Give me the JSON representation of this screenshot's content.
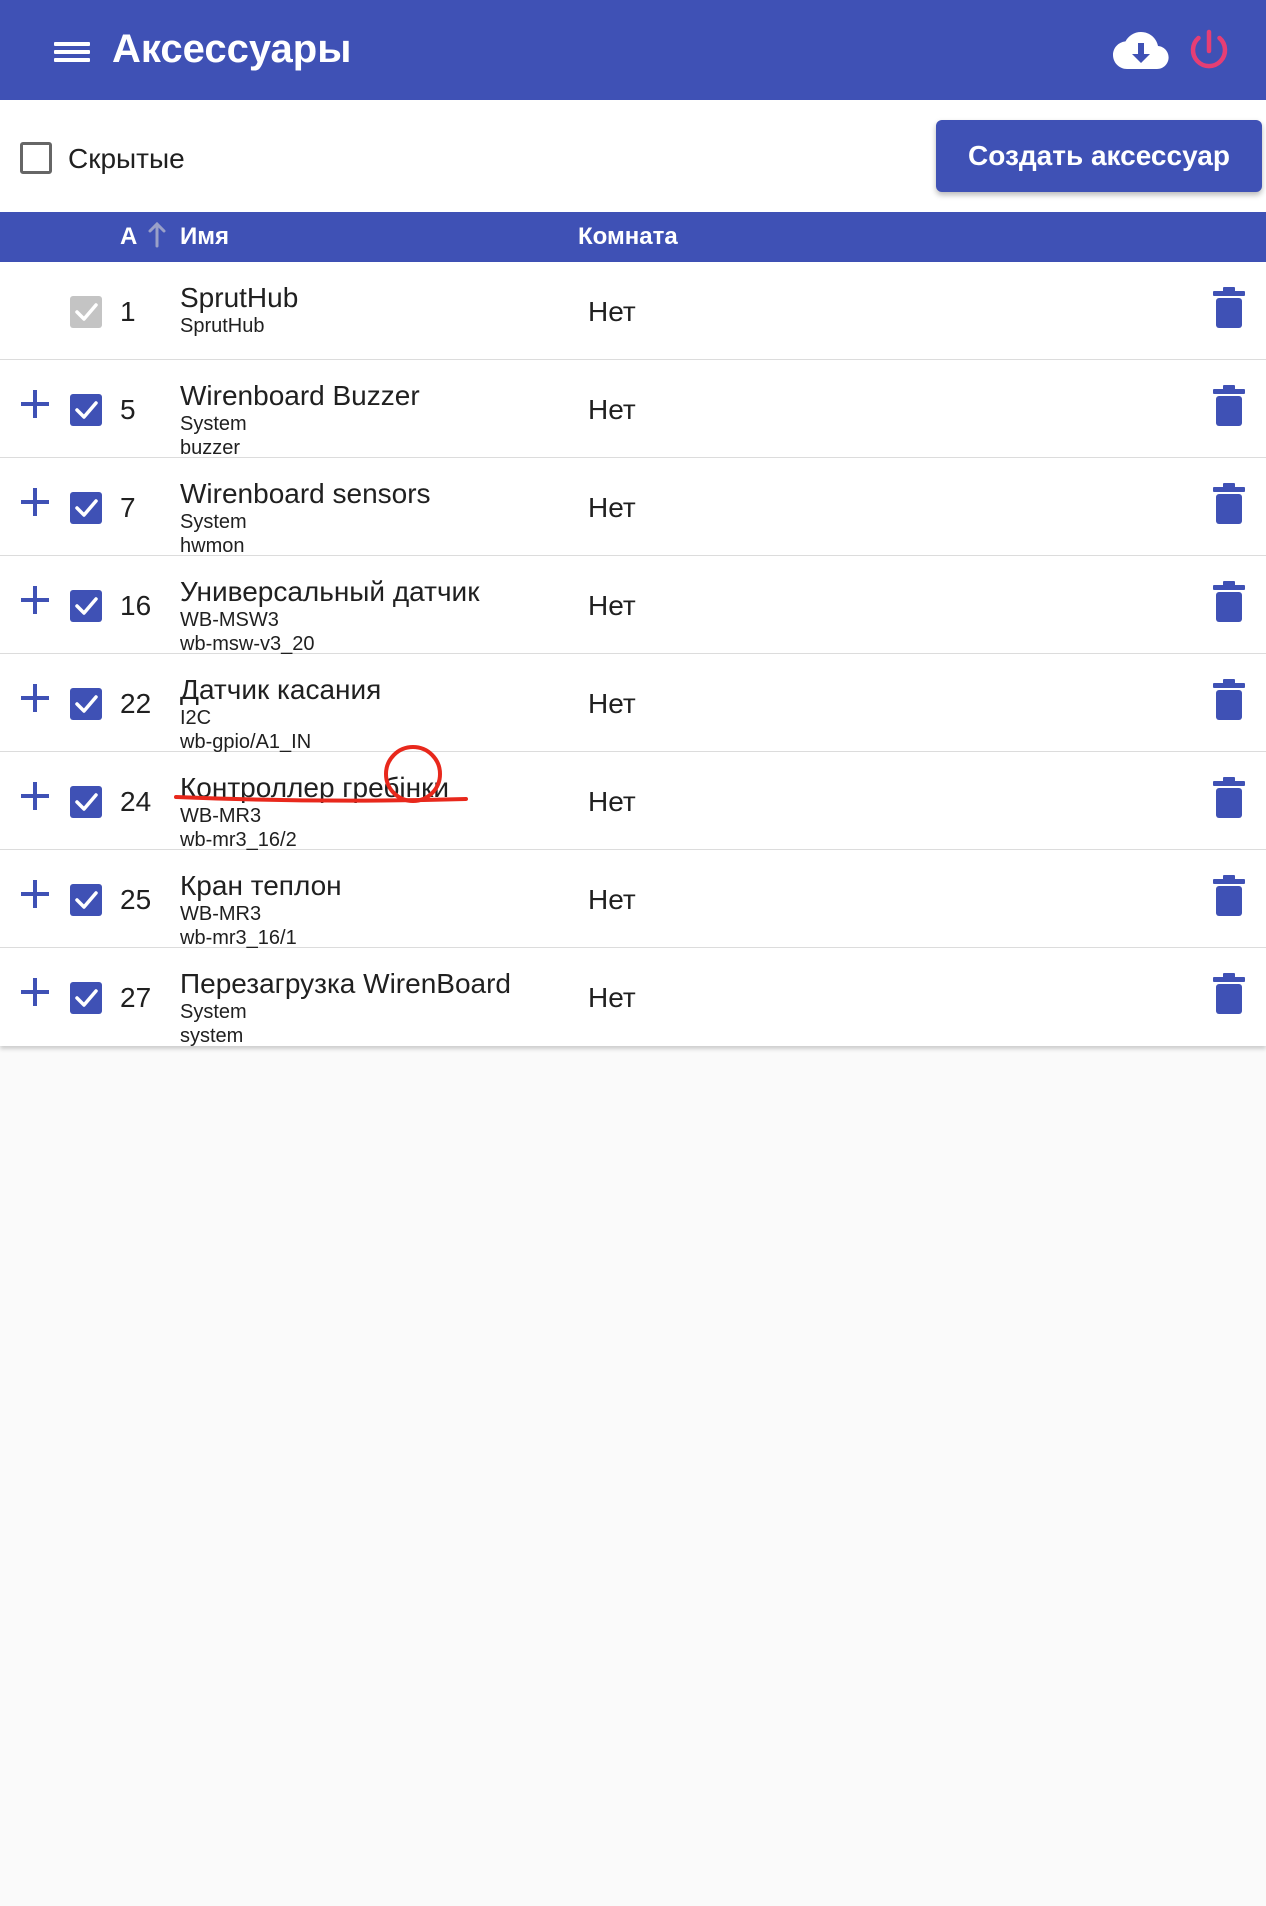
{
  "app": {
    "title": "Аксессуары",
    "menu_icon": "menu-icon",
    "cloud_icon": "cloud-download-icon",
    "power_icon": "power-icon",
    "accent": "#3f51b5",
    "power_color": "#e53e74"
  },
  "toolbar": {
    "hidden_label": "Скрытые",
    "hidden_checked": false,
    "create_label": "Создать аксессуар"
  },
  "table": {
    "headers": {
      "a": "A",
      "name": "Имя",
      "room": "Комната"
    },
    "sort": {
      "column": "A",
      "direction": "ascending"
    },
    "rows": [
      {
        "expandable": false,
        "checked": true,
        "enabled": false,
        "id": "1",
        "name": "SprutHub",
        "sub1": "SprutHub",
        "sub2": "",
        "room": "Нет"
      },
      {
        "expandable": true,
        "checked": true,
        "enabled": true,
        "id": "5",
        "name": "Wirenboard Buzzer",
        "sub1": "System",
        "sub2": "buzzer",
        "room": "Нет"
      },
      {
        "expandable": true,
        "checked": true,
        "enabled": true,
        "id": "7",
        "name": "Wirenboard sensors",
        "sub1": "System",
        "sub2": "hwmon",
        "room": "Нет"
      },
      {
        "expandable": true,
        "checked": true,
        "enabled": true,
        "id": "16",
        "name": "Универсальный датчик",
        "sub1": "WB-MSW3",
        "sub2": "wb-msw-v3_20",
        "room": "Нет"
      },
      {
        "expandable": true,
        "checked": true,
        "enabled": true,
        "id": "22",
        "name": "Датчик касания",
        "sub1": "I2C",
        "sub2": "wb-gpio/A1_IN",
        "room": "Нет"
      },
      {
        "expandable": true,
        "checked": true,
        "enabled": true,
        "id": "24",
        "name": "Контроллер гребінки",
        "sub1": "WB-MR3",
        "sub2": "wb-mr3_16/2",
        "room": "Нет"
      },
      {
        "expandable": true,
        "checked": true,
        "enabled": true,
        "id": "25",
        "name": "Кран теплон",
        "sub1": "WB-MR3",
        "sub2": "wb-mr3_16/1",
        "room": "Нет"
      },
      {
        "expandable": true,
        "checked": true,
        "enabled": true,
        "id": "27",
        "name": "Перезагрузка WirenBoard",
        "sub1": "System",
        "sub2": "system",
        "room": "Нет"
      }
    ]
  },
  "annotation": {
    "color": "#e8281c",
    "marks": [
      "red-underline",
      "red-circle"
    ]
  }
}
